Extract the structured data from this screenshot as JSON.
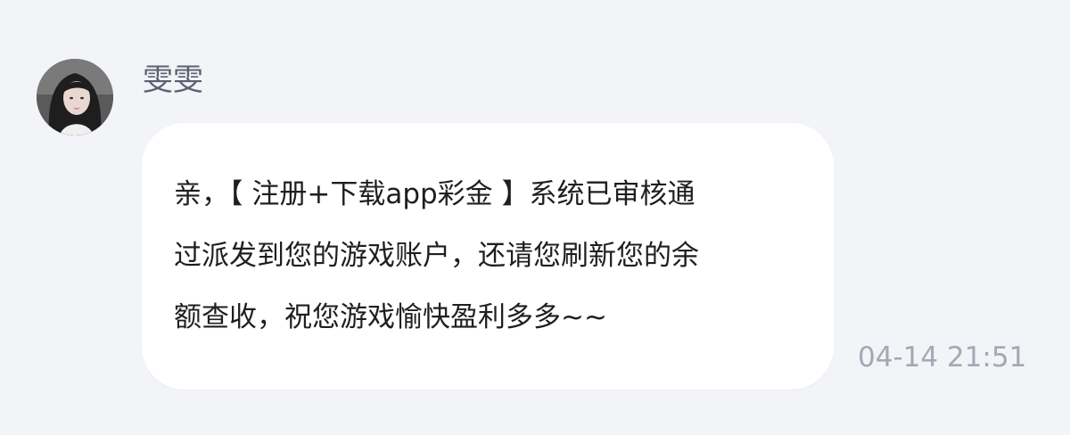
{
  "message": {
    "sender_name": "雯雯",
    "avatar": "female-portrait-avatar",
    "text_lines": [
      "亲，【 注册+下载app彩金 】系统已审核通",
      "过派发到您的游戏账户，还请您刷新您的余",
      "额查收，祝您游戏愉快盈利多多~~"
    ],
    "timestamp": "04-14 21:51"
  },
  "colors": {
    "page_background": "#f2f4f8",
    "bubble_background": "#ffffff",
    "name_text": "#5b6170",
    "message_text": "#1f1f1f",
    "timestamp_text": "#a3a8b3"
  }
}
